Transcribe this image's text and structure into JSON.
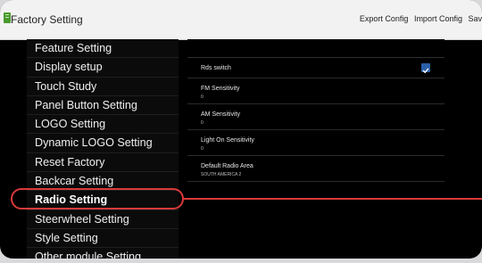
{
  "window": {
    "title": "Factory Setting",
    "actions": [
      "Export Config",
      "Import Config",
      "Sav"
    ]
  },
  "menu": {
    "items": [
      {
        "label": "Feature Setting"
      },
      {
        "label": "Display setup"
      },
      {
        "label": "Touch Study"
      },
      {
        "label": "Panel Button Setting"
      },
      {
        "label": "LOGO Setting"
      },
      {
        "label": "Dynamic LOGO Setting"
      },
      {
        "label": "Reset Factory"
      },
      {
        "label": "Backcar Setting"
      },
      {
        "label": "Radio Setting",
        "selected": true
      },
      {
        "label": "Steerwheel Setting"
      },
      {
        "label": "Style Setting"
      },
      {
        "label": "Other module Setting"
      }
    ]
  },
  "radio": {
    "rds_switch": {
      "label": "Rds switch",
      "checked": true
    },
    "fm_sensitivity": {
      "label": "FM Sensitivity",
      "value": "0"
    },
    "am_sensitivity": {
      "label": "AM Sensitivity",
      "value": "0"
    },
    "light_on_sensitivity": {
      "label": "Light On Sensitivity",
      "value": "0"
    },
    "default_radio_area": {
      "label": "Default Radio Area",
      "value": "SOUTH AMERICA 2"
    }
  },
  "colors": {
    "highlight": "#d93a3a",
    "checkbox": "#2b5fa8",
    "titlebar": "#f2f2f2",
    "background": "#000000",
    "icon": "#4a9a2e"
  }
}
